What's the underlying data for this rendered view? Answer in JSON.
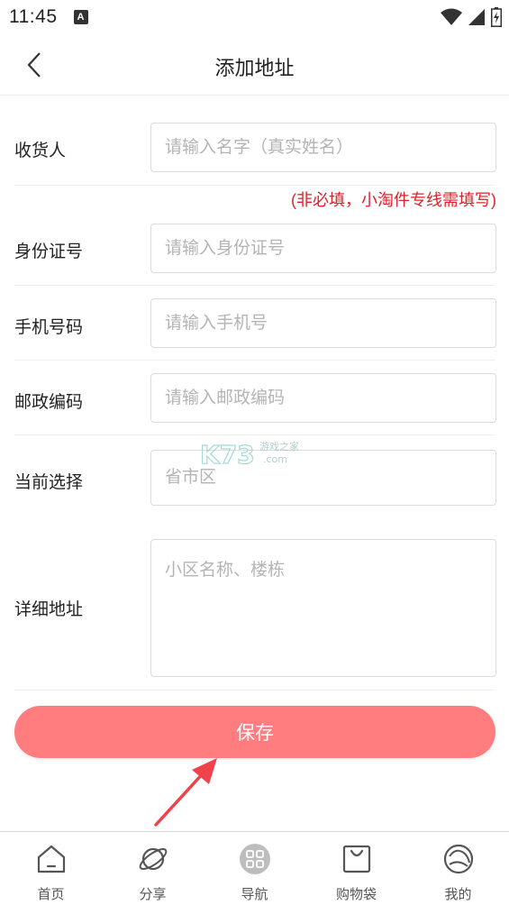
{
  "status": {
    "time": "11:45",
    "a_badge": "A",
    "icons": [
      "wifi-icon",
      "signal-icon",
      "battery-icon"
    ]
  },
  "header": {
    "title": "添加地址",
    "back_icon": "chevron-left-icon"
  },
  "form": {
    "recipient": {
      "label": "收货人",
      "value": "",
      "placeholder": "请输入名字（真实姓名）"
    },
    "note": "(非必填，小淘件专线需填写)",
    "id_number": {
      "label": "身份证号",
      "value": "",
      "placeholder": "请输入身份证号"
    },
    "phone": {
      "label": "手机号码",
      "value": "",
      "placeholder": "请输入手机号"
    },
    "postal": {
      "label": "邮政编码",
      "value": "",
      "placeholder": "请输入邮政编码"
    },
    "region": {
      "label": "当前选择",
      "value": "",
      "placeholder": "省市区"
    },
    "detail": {
      "label": "详细地址",
      "value": "",
      "placeholder": "小区名称、楼栋"
    }
  },
  "save_label": "保存",
  "watermark": {
    "logo": "K73",
    "text": "游戏之家",
    "domain": ".com"
  },
  "tabs": [
    {
      "label": "首页",
      "icon": "home-icon"
    },
    {
      "label": "分享",
      "icon": "planet-icon"
    },
    {
      "label": "导航",
      "icon": "grid-icon"
    },
    {
      "label": "购物袋",
      "icon": "shopping-bag-icon"
    },
    {
      "label": "我的",
      "icon": "profile-icon"
    }
  ],
  "colors": {
    "accent": "#ff7d7f",
    "note": "#e0202a",
    "arrow": "#f0424a"
  }
}
